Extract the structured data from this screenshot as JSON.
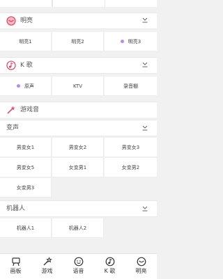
{
  "sections": {
    "bright": {
      "title": "明亮",
      "items": [
        "明亮1",
        "明亮2",
        "明亮3"
      ],
      "selected_index": 2
    },
    "karaoke": {
      "title": "K 歌",
      "items": [
        "原声",
        "KTV",
        "录音棚"
      ],
      "selected_index": 0
    },
    "game_voice": {
      "title": "游戏音",
      "voice_change": {
        "title": "变声",
        "items": [
          "男变女1",
          "男变女2",
          "男变女3",
          "男变女5",
          "女变男1",
          "女变男2",
          "女变男3"
        ]
      },
      "robot": {
        "title": "机器人",
        "items": [
          "机器人1",
          "机器人2"
        ]
      }
    }
  },
  "bottom_nav": [
    {
      "label": "画板",
      "icon": "drawing-board-icon"
    },
    {
      "label": "游戏",
      "icon": "game-magic-wand-icon"
    },
    {
      "label": "语音",
      "icon": "smiley-icon"
    },
    {
      "label": "K 歌",
      "icon": "music-note-icon"
    },
    {
      "label": "明亮",
      "icon": "bright-face-icon"
    }
  ],
  "colors": {
    "accent": "#b78be6",
    "brand_icon": "#d9536b",
    "background": "#f1f1f1"
  }
}
